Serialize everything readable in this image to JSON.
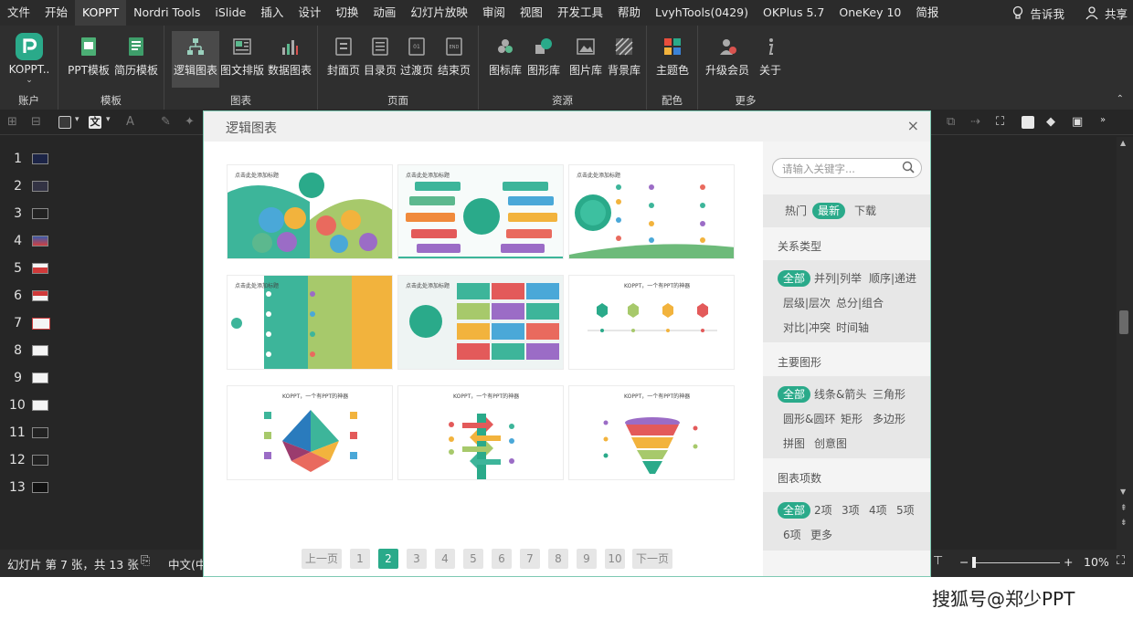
{
  "menubar": {
    "items": [
      "文件",
      "开始",
      "KOPPT",
      "Nordri Tools",
      "iSlide",
      "插入",
      "设计",
      "切换",
      "动画",
      "幻灯片放映",
      "审阅",
      "视图",
      "开发工具",
      "帮助",
      "LvyhTools(0429)",
      "OKPlus 5.7",
      "OneKey 10",
      "简报"
    ],
    "active_index": 2,
    "tell_me": "告诉我",
    "share": "共享"
  },
  "ribbon": {
    "account": {
      "button": "KOPPT..",
      "label": "账户"
    },
    "template": {
      "buttons": [
        "PPT模板",
        "简历模板"
      ],
      "label": "模板"
    },
    "chart": {
      "buttons": [
        "逻辑图表",
        "图文排版",
        "数据图表"
      ],
      "label": "图表",
      "selected_index": 0
    },
    "page": {
      "buttons": [
        "封面页",
        "目录页",
        "过渡页",
        "结束页"
      ],
      "label": "页面"
    },
    "resource": {
      "buttons": [
        "图标库",
        "图形库",
        "图片库",
        "背景库"
      ],
      "label": "资源"
    },
    "color": {
      "buttons": [
        "主题色"
      ],
      "label": "配色"
    },
    "more": {
      "buttons": [
        "升级会员",
        "关于"
      ],
      "label": "更多"
    }
  },
  "toolbar2": {
    "text_button": "文"
  },
  "slides": {
    "numbers": [
      "1",
      "2",
      "3",
      "4",
      "5",
      "6",
      "7",
      "8",
      "9",
      "10",
      "11",
      "12",
      "13"
    ],
    "current_index": 6
  },
  "statusbar": {
    "slide_info": "幻灯片 第 7 张，共 13 张",
    "language": "中文(中",
    "zoom": "10%",
    "zoom_minus": "−",
    "zoom_plus": "+"
  },
  "dialog": {
    "title": "逻辑图表",
    "close": "×",
    "thumbnails": [
      {
        "title": "点击此处添加标题"
      },
      {
        "title": "点击此处添加标题"
      },
      {
        "title": "点击此处添加标题"
      },
      {
        "title": "点击此处添加标题"
      },
      {
        "title": "点击此处添加标题"
      },
      {
        "title": "KOPPT，一个有PPT的神器"
      },
      {
        "title": "KOPPT，一个有PPT的神器"
      },
      {
        "title": "KOPPT，一个有PPT的神器"
      },
      {
        "title": "KOPPT，一个有PPT的神器"
      }
    ],
    "pager": {
      "prev": "上一页",
      "pages": [
        "1",
        "2",
        "3",
        "4",
        "5",
        "6",
        "7",
        "8",
        "9",
        "10"
      ],
      "current_index": 1,
      "next": "下一页"
    }
  },
  "sidepanel": {
    "search_placeholder": "请输入关键字...",
    "sort_tabs": [
      "热门",
      "最新",
      "下载"
    ],
    "sort_active_index": 1,
    "relation": {
      "title": "关系类型",
      "options": [
        "全部",
        "并列|列举",
        "顺序|递进",
        "层级|层次",
        "总分|组合",
        "对比|冲突",
        "时间轴"
      ],
      "active_index": 0
    },
    "shape": {
      "title": "主要图形",
      "options": [
        "全部",
        "线条&箭头",
        "三角形",
        "圆形&圆环",
        "矩形",
        "多边形",
        "拼图",
        "创意图"
      ],
      "active_index": 0
    },
    "count": {
      "title": "图表项数",
      "options": [
        "全部",
        "2项",
        "3项",
        "4项",
        "5项",
        "6项",
        "更多"
      ],
      "active_index": 0
    }
  },
  "watermark": "搜狐号@郑少PPT",
  "colors": {
    "accent": "#2aaa8a",
    "dark_bg": "#262626",
    "ribbon_bg": "#2f2f2f"
  }
}
